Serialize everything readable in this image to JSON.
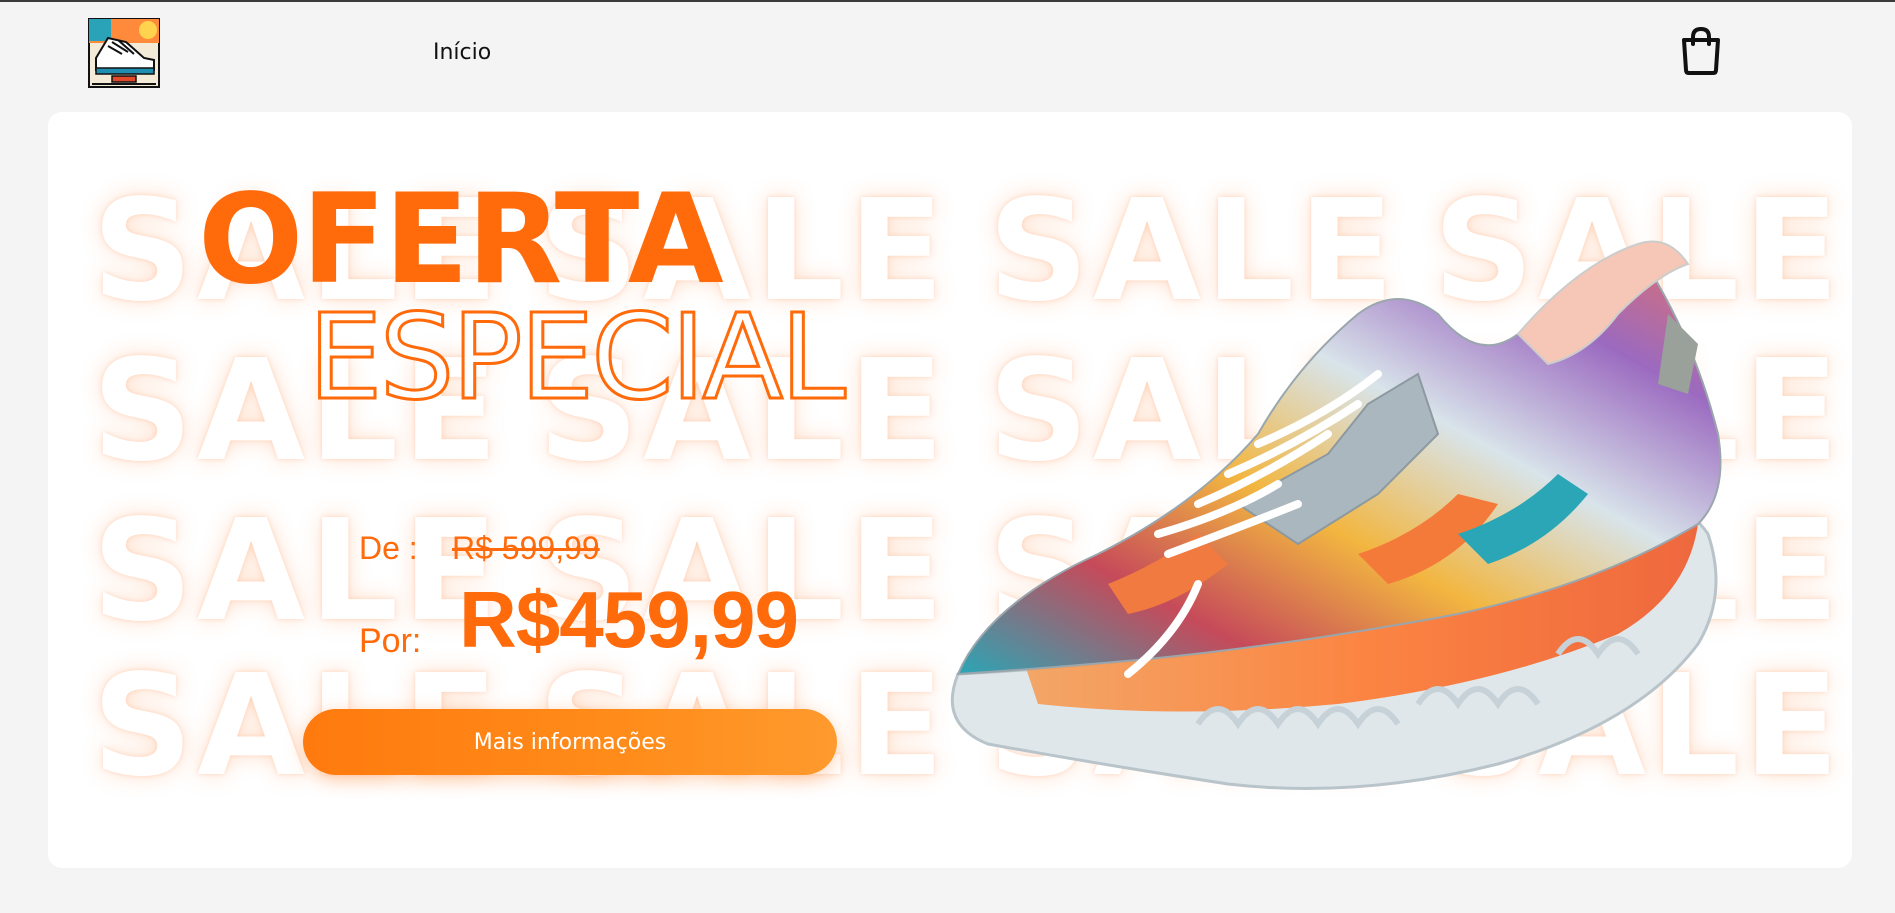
{
  "header": {
    "logo_icon": "sneaker-logo-icon",
    "nav_home_label": "Início",
    "cart_icon": "shopping-bag-icon"
  },
  "banner": {
    "background_word": "SALE",
    "headline_line1": "OFERTA",
    "headline_line2": "ESPECIAL",
    "price_from_label": "De :",
    "price_from_value": "R$ 599,99",
    "price_to_label": "Por:",
    "price_to_value": "R$459,99",
    "cta_label": "Mais informações",
    "product_image": "sneaker-product-image"
  },
  "colors": {
    "accent": "#ff6a0a",
    "button": "#ff8c1a",
    "page_bg": "#f4f4f4",
    "card_bg": "#ffffff"
  }
}
